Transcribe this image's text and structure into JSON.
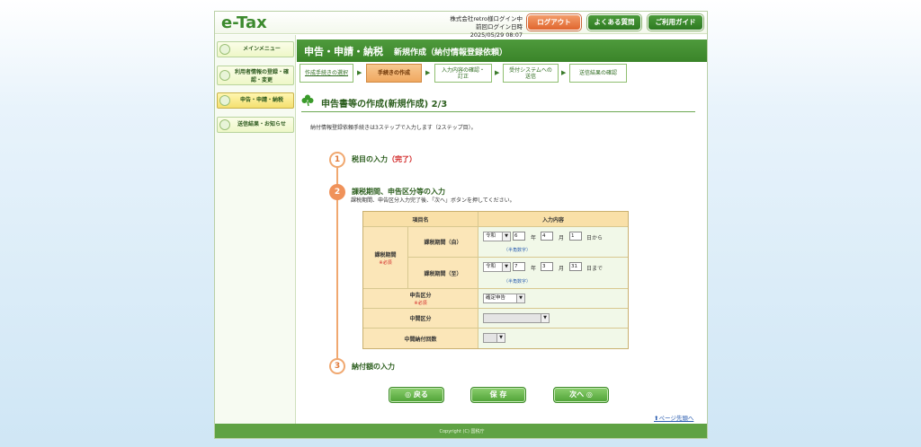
{
  "header": {
    "logo": "e-Tax",
    "user_line1": "株式会社retro様ログイン中",
    "user_line2": "前回ログイン日時　2025/05/29 08:07",
    "logout": "ログアウト",
    "faq": "よくある質問",
    "guide": "ご利用ガイド"
  },
  "sidebar": {
    "items": [
      {
        "label": "メインメニュー"
      },
      {
        "label": "利用者情報の登録・確認・変更"
      },
      {
        "label": "申告・申請・納税"
      },
      {
        "label": "送信結果・お知らせ"
      }
    ]
  },
  "titlebar": {
    "title": "申告・申請・納税",
    "subtitle": "新規作成（納付情報登録依頼）"
  },
  "steps": [
    {
      "label": "作成手続きの選択"
    },
    {
      "label": "手続きの作成"
    },
    {
      "label": "入力内容の確認・訂正"
    },
    {
      "label": "受付システムへの送信"
    },
    {
      "label": "送信結果の確認"
    }
  ],
  "heading": "申告書等の作成(新規作成) 2/3",
  "intro": "納付情報登録依頼手続きは3ステップで入力します（2ステップ目）。",
  "step_markers": [
    {
      "num": "1",
      "label": "税目の入力",
      "status": "（完了）"
    },
    {
      "num": "2",
      "label": "課税期間、申告区分等の入力"
    },
    {
      "num": "3",
      "label": "納付額の入力"
    }
  ],
  "step2_instruction": "課税期間、申告区分入力完了後、「次へ」ボタンを押してください。",
  "form": {
    "col_item": "項目名",
    "col_input": "入力内容",
    "period_group": "課税期間",
    "required": "※必須",
    "from_label": "課税期間（自）",
    "to_label": "課税期間（至）",
    "era": "令和",
    "from": {
      "year": "6",
      "month": "4",
      "day": "1"
    },
    "to": {
      "year": "7",
      "month": "3",
      "day": "31"
    },
    "unit_year": "年",
    "unit_month": "月",
    "unit_day_from": "日から",
    "unit_day_to": "日まで",
    "halfwidth_hint": "（半角数字）",
    "declaration_label": "申告区分",
    "declaration_value": "確定申告",
    "interim_label": "中間区分",
    "interim_value": "",
    "interim_count_label": "中間納付回数",
    "interim_count_value": ""
  },
  "buttons": {
    "back": "◎ 戻る",
    "save": "保 存",
    "next": "次へ ◎"
  },
  "pagetop": "ページ先頭へ",
  "footer": "Copyright (C) 国税庁",
  "colors": {
    "brand_green": "#3a8429",
    "accent_orange": "#f0925a",
    "required_red": "#d02020"
  }
}
